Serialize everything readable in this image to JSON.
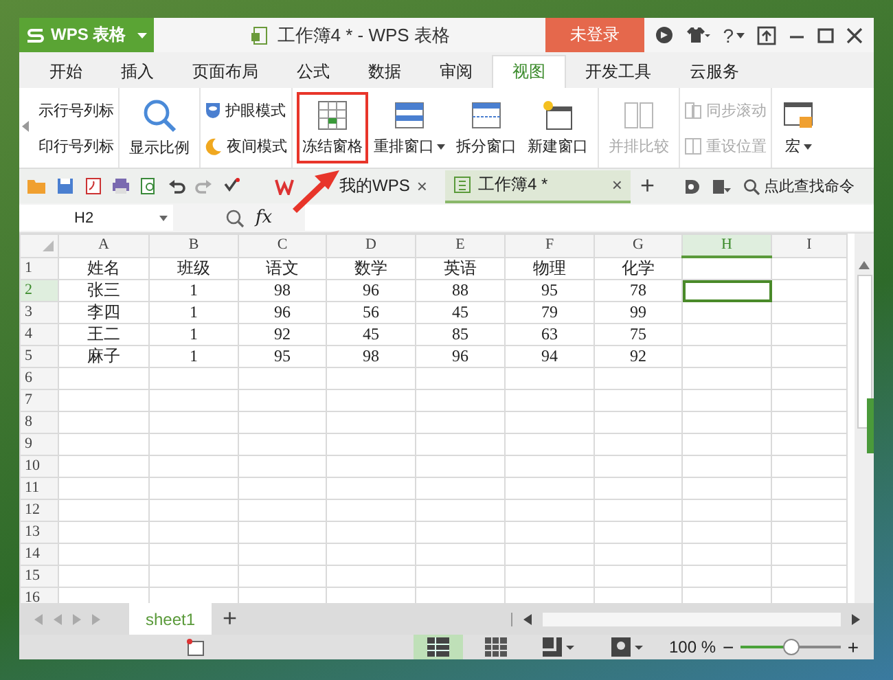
{
  "window": {
    "app_menu": "WPS 表格",
    "title": "工作簿4 * - WPS 表格",
    "login": "未登录",
    "help": "?"
  },
  "menu_tabs": [
    {
      "label": "开始",
      "selected": false
    },
    {
      "label": "插入",
      "selected": false
    },
    {
      "label": "页面布局",
      "selected": false
    },
    {
      "label": "公式",
      "selected": false
    },
    {
      "label": "数据",
      "selected": false
    },
    {
      "label": "审阅",
      "selected": false
    },
    {
      "label": "视图",
      "selected": true
    },
    {
      "label": "开发工具",
      "selected": false
    },
    {
      "label": "云服务",
      "selected": false
    }
  ],
  "ribbon": [
    {
      "kind": "stack",
      "items": [
        {
          "label": "示行号列标",
          "disabled": false
        },
        {
          "label": "印行号列标",
          "disabled": false
        }
      ]
    },
    {
      "kind": "big",
      "items": [
        {
          "label": "显示比例",
          "dropdown": false,
          "disabled": false,
          "highlighted": false
        }
      ]
    },
    {
      "kind": "stack",
      "items": [
        {
          "label": "护眼模式",
          "disabled": false
        },
        {
          "label": "夜间模式",
          "disabled": false
        }
      ]
    },
    {
      "kind": "big",
      "items": [
        {
          "label": "冻结窗格",
          "dropdown": false,
          "disabled": false,
          "highlighted": true
        },
        {
          "label": "重排窗口",
          "dropdown": true,
          "disabled": false,
          "highlighted": false
        },
        {
          "label": "拆分窗口",
          "dropdown": false,
          "disabled": false,
          "highlighted": false
        },
        {
          "label": "新建窗口",
          "dropdown": false,
          "disabled": false,
          "highlighted": false
        }
      ]
    },
    {
      "kind": "big",
      "items": [
        {
          "label": "并排比较",
          "dropdown": false,
          "disabled": true,
          "highlighted": false
        }
      ]
    },
    {
      "kind": "stack",
      "items": [
        {
          "label": "同步滚动",
          "disabled": true
        },
        {
          "label": "重设位置",
          "disabled": true
        }
      ]
    },
    {
      "kind": "big",
      "items": [
        {
          "label": "宏",
          "dropdown": true,
          "disabled": false,
          "highlighted": false
        }
      ]
    }
  ],
  "doc_tabs": [
    {
      "label": "我的WPS",
      "selected": false,
      "close": "×"
    },
    {
      "label": "工作簿4 *",
      "selected": true,
      "close": "×"
    }
  ],
  "new_tab": "+",
  "command_search": {
    "placeholder": "点此查找命令"
  },
  "formula_bar": {
    "name_box": "H2",
    "fx": "fx"
  },
  "columns": [
    {
      "label": "A",
      "selected": false
    },
    {
      "label": "B",
      "selected": false
    },
    {
      "label": "C",
      "selected": false
    },
    {
      "label": "D",
      "selected": false
    },
    {
      "label": "E",
      "selected": false
    },
    {
      "label": "F",
      "selected": false
    },
    {
      "label": "G",
      "selected": false
    },
    {
      "label": "H",
      "selected": true
    },
    {
      "label": "I",
      "selected": false
    }
  ],
  "rows": [
    {
      "number": "1",
      "selected": false,
      "cells": [
        "姓名",
        "班级",
        "语文",
        "数学",
        "英语",
        "物理",
        "化学"
      ]
    },
    {
      "number": "2",
      "selected": true,
      "cells": [
        "张三",
        "1",
        "98",
        "96",
        "88",
        "95",
        "78"
      ]
    },
    {
      "number": "3",
      "selected": false,
      "cells": [
        "李四",
        "1",
        "96",
        "56",
        "45",
        "79",
        "99"
      ]
    },
    {
      "number": "4",
      "selected": false,
      "cells": [
        "王二",
        "1",
        "92",
        "45",
        "85",
        "63",
        "75"
      ]
    },
    {
      "number": "5",
      "selected": false,
      "cells": [
        "麻子",
        "1",
        "95",
        "98",
        "96",
        "94",
        "92"
      ]
    },
    {
      "number": "6",
      "selected": false,
      "cells": []
    },
    {
      "number": "7",
      "selected": false,
      "cells": []
    },
    {
      "number": "8",
      "selected": false,
      "cells": []
    },
    {
      "number": "9",
      "selected": false,
      "cells": []
    },
    {
      "number": "10",
      "selected": false,
      "cells": []
    },
    {
      "number": "11",
      "selected": false,
      "cells": []
    },
    {
      "number": "12",
      "selected": false,
      "cells": []
    },
    {
      "number": "13",
      "selected": false,
      "cells": []
    },
    {
      "number": "14",
      "selected": false,
      "cells": []
    },
    {
      "number": "15",
      "selected": false,
      "cells": []
    },
    {
      "number": "16",
      "selected": false,
      "cells": []
    }
  ],
  "sheet_tabs": [
    {
      "label": "sheet1",
      "selected": true
    }
  ],
  "add_sheet": "+",
  "status_bar": {
    "views": [
      {
        "kind": "normal",
        "selected": true
      },
      {
        "kind": "page-break",
        "selected": false
      },
      {
        "kind": "layout",
        "selected": false
      },
      {
        "kind": "reading",
        "selected": false
      }
    ],
    "zoom": "100 %",
    "zoom_out": "−",
    "zoom_in": "+",
    "zoom_slider": {
      "level": 0.5
    }
  }
}
